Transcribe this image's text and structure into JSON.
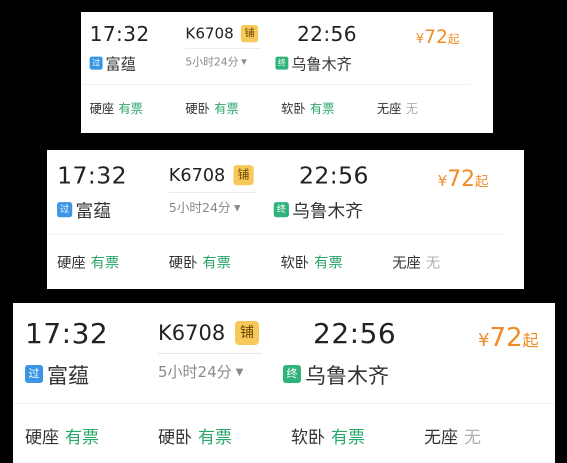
{
  "ticket": {
    "departure_time": "17:32",
    "train_number": "K6708",
    "berth_badge": "铺",
    "arrival_time": "22:56",
    "price_symbol": "¥",
    "price": "72",
    "price_suffix": "起",
    "departure_type": "过",
    "departure_station": "富蕴",
    "duration": "5小时24分",
    "arrival_type": "终",
    "arrival_station": "乌鲁木齐",
    "seats": [
      {
        "type": "硬座",
        "status": "有票"
      },
      {
        "type": "硬卧",
        "status": "有票"
      },
      {
        "type": "软卧",
        "status": "有票"
      },
      {
        "type": "无座",
        "status": "无"
      }
    ]
  },
  "colors": {
    "price": "#f08c28",
    "available": "#2aa66a",
    "unavailable": "#b0b0b0",
    "pass_badge": "#3a96e4",
    "end_badge": "#2fb37a",
    "berth_badge": "#f7c95b"
  }
}
